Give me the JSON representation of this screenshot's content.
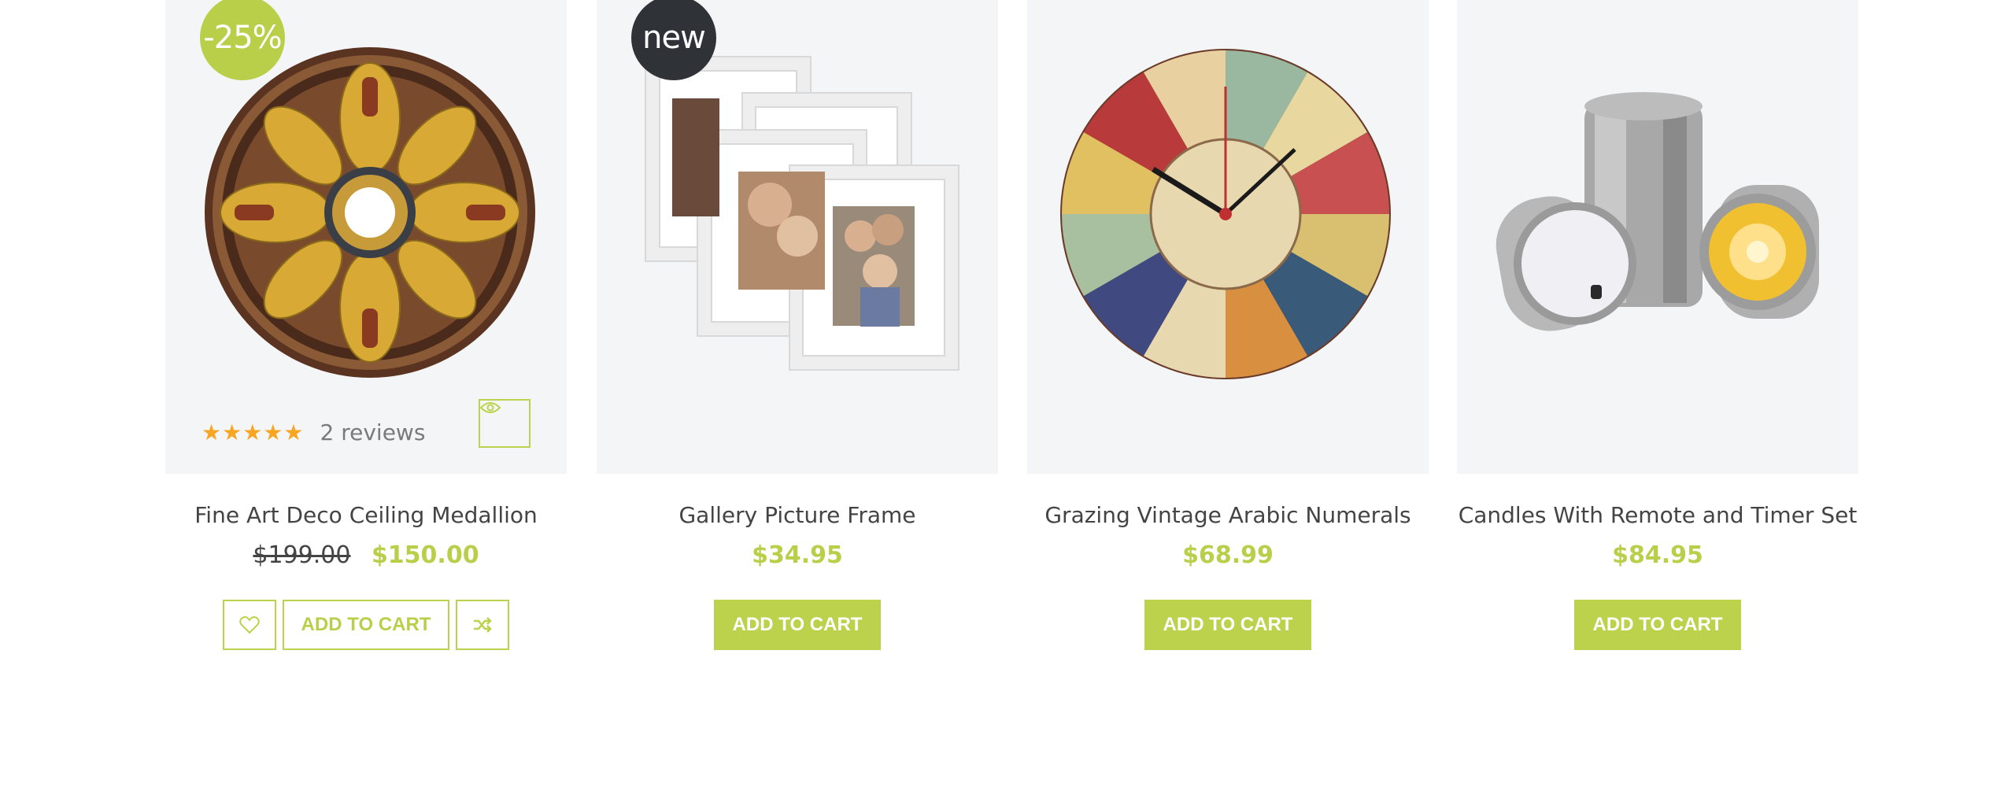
{
  "products": [
    {
      "badge": "-25%",
      "rating_stars": "★★★★★",
      "reviews": "2 reviews",
      "title": "Fine Art Deco Ceiling Medallion",
      "old_price": "$199.00",
      "price": "$150.00",
      "add_to_cart": "ADD TO CART",
      "icons": [
        "eye-icon",
        "heart-icon",
        "shuffle-icon"
      ]
    },
    {
      "badge": "new",
      "title": "Gallery Picture Frame",
      "price": "$34.95",
      "add_to_cart": "ADD TO CART"
    },
    {
      "title": "Grazing  Vintage Arabic Numerals",
      "price": "$68.99",
      "add_to_cart": "ADD TO CART"
    },
    {
      "title": "Candles With Remote and Timer Set",
      "price": "$84.95",
      "add_to_cart": "ADD TO CART"
    }
  ],
  "colors": {
    "accent": "#bdd24c",
    "badge_dark": "#2f3337",
    "card_bg": "#f4f5f7",
    "star": "#f6a623"
  }
}
